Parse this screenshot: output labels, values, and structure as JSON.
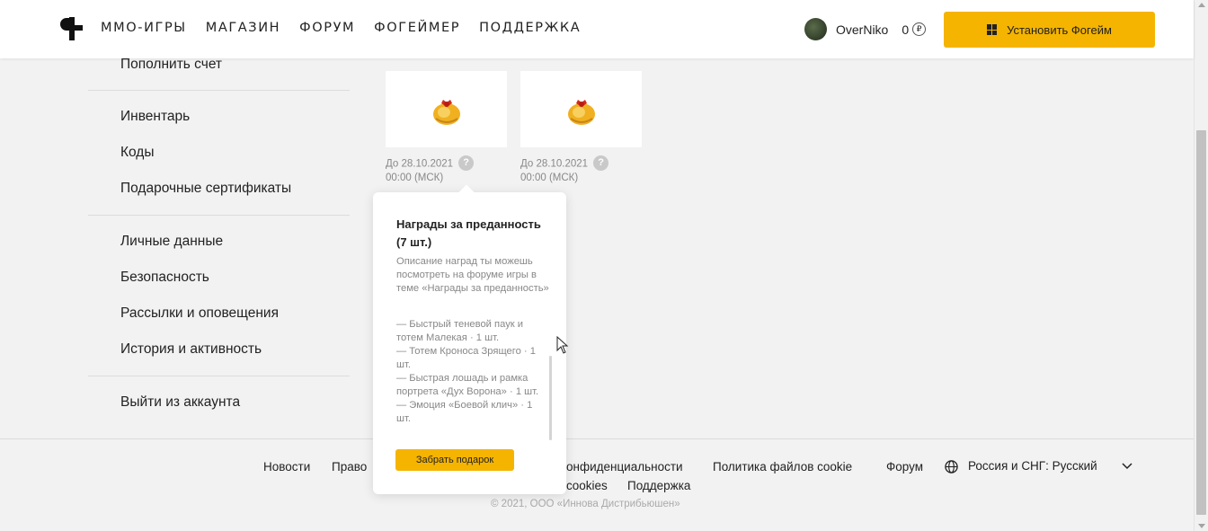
{
  "header": {
    "nav": [
      "ММО-ИГРЫ",
      "МАГАЗИН",
      "ФОРУМ",
      "ФОГЕЙМЕР",
      "ПОДДЕРЖКА"
    ],
    "username": "OverNiko",
    "balance": "0",
    "currency_symbol": "₽",
    "install_label": "Установить Фогейм"
  },
  "sidebar": {
    "top_up": "Пополнить счет",
    "inventory": "Инвентарь",
    "codes": "Коды",
    "gift_certificates": "Подарочные сертификаты",
    "personal_data": "Личные данные",
    "security": "Безопасность",
    "mailings": "Рассылки и оповещения",
    "history": "История и активность",
    "logout": "Выйти из аккаунта"
  },
  "rewards": [
    {
      "date_line1": "До 28.10.2021",
      "date_line2": "00:00 (МСК)"
    },
    {
      "date_line1": "До 28.10.2021",
      "date_line2": "00:00 (МСК)"
    }
  ],
  "popup": {
    "title": "Награды за преданность (7 шт.)",
    "description": "Описание наград ты можешь посмотреть на форуме игры в теме «Награды за преданность»",
    "items": [
      "— Быстрый теневой паук и тотем Малекая · 1 шт.",
      "— Тотем Кроноса Зрящего · 1 шт.",
      "— Быстрая лошадь и рамка портрета «Дух Ворона» · 1 шт.",
      "— Эмоция «Боевой клич» · 1 шт."
    ],
    "claim_label": "Забрать подарок"
  },
  "footer": {
    "news": "Новости",
    "rights": "Право",
    "privacy": "онфиденциальности",
    "cookie_policy": "Политика файлов cookie",
    "forum": "Форум",
    "region": "Россия и СНГ: Русский",
    "cookies": "cookies",
    "support": "Поддержка",
    "copyright": "© 2021, ООО «Иннова Дистрибьюшен»"
  },
  "colors": {
    "accent": "#f5b400",
    "background": "#f2f2f2"
  }
}
